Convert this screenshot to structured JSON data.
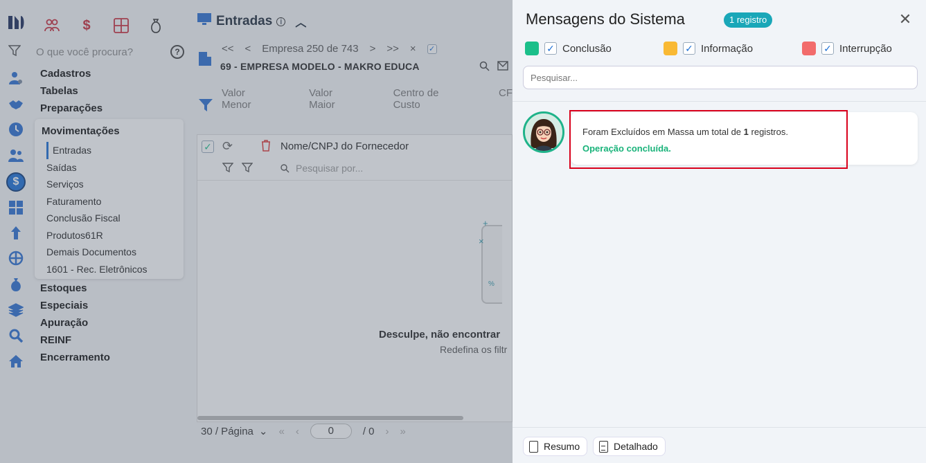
{
  "app": {
    "search_placeholder": "O que você procura?",
    "help_label": "?",
    "menu_top": [
      "Cadastros",
      "Tabelas",
      "Preparações"
    ],
    "submenu": {
      "title": "Movimentações",
      "items": [
        "Entradas",
        "Saídas",
        "Serviços",
        "Faturamento",
        "Conclusão Fiscal",
        "Produtos61R",
        "Demais Documentos",
        "1601 - Rec. Eletrônicos"
      ]
    },
    "menu_bottom": [
      "Estoques",
      "Especiais",
      "Apuração",
      "REINF",
      "Encerramento"
    ]
  },
  "main": {
    "title": "Entradas",
    "nav": {
      "first": "<<",
      "prev": "<",
      "label": "Empresa",
      "current": "250",
      "of": "de",
      "total": "743",
      "next": ">",
      "last": ">>",
      "close": "×"
    },
    "company": "69 - EMPRESA MODELO - MAKRO EDUCA",
    "filters": [
      "Valor Menor",
      "Valor Maior",
      "Centro de Custo",
      "CF"
    ],
    "grid": {
      "column": "Nome/CNPJ do Fornecedor",
      "search_placeholder": "Pesquisar por...",
      "empty_title": "Desculpe, não encontrar",
      "empty_sub": "Redefina os filtr"
    },
    "pager": {
      "per_page": "30 / Página",
      "page": "0",
      "of_total": "/ 0"
    }
  },
  "panel": {
    "title": "Mensagens do Sistema",
    "badge": "1 registro",
    "close": "✕",
    "legend": [
      {
        "label": "Conclusão",
        "color": "#1bbf8a"
      },
      {
        "label": "Informação",
        "color": "#f9b934"
      },
      {
        "label": "Interrupção",
        "color": "#f26b6b"
      }
    ],
    "search_placeholder": "Pesquisar...",
    "message": {
      "prefix": "Foram Excluídos em Massa um total de",
      "count": "1",
      "suffix": "registros.",
      "status": "Operação concluída."
    },
    "buttons": {
      "summary": "Resumo",
      "detailed": "Detalhado"
    }
  }
}
